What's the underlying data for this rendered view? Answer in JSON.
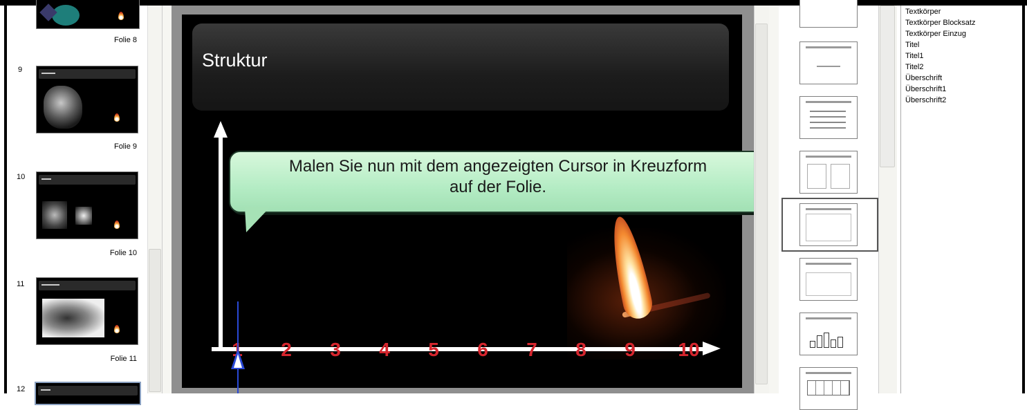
{
  "slide_panel": {
    "labels": [
      "Folie 8",
      "Folie 9",
      "Folie 10",
      "Folie 11"
    ],
    "numbers": [
      "9",
      "10",
      "11",
      "12"
    ]
  },
  "slide": {
    "title": "Struktur",
    "callout_line1": "Malen Sie nun mit dem angezeigten Cursor in Kreuzform",
    "callout_line2": "auf der Folie.",
    "axis_ticks": [
      "1",
      "2",
      "3",
      "4",
      "5",
      "6",
      "7",
      "8",
      "9",
      "10"
    ]
  },
  "styles_list": [
    "Textkörper",
    "Textkörper Blocksatz",
    "Textkörper Einzug",
    "Titel",
    "Titel1",
    "Titel2",
    "Überschrift",
    "Überschrift1",
    "Überschrift2"
  ],
  "colors": {
    "axis": "#ffffff",
    "tick_numbers": "#d6262e",
    "callout_fill": "#b4ecc4",
    "cursor": "#2a49d6"
  }
}
